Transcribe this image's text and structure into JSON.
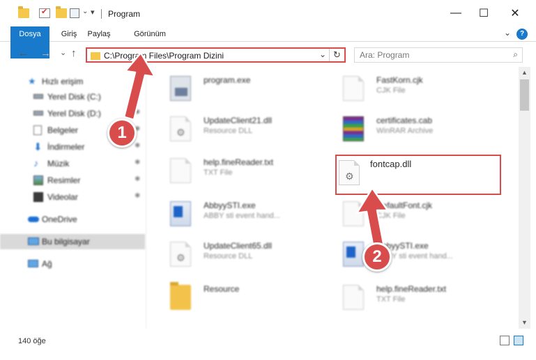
{
  "window": {
    "title": "Program",
    "min_glyph": "—",
    "max_glyph": "☐",
    "close_glyph": "✕"
  },
  "ribbon": {
    "tabs": [
      "Dosya",
      "Giriş",
      "Paylaş",
      "Görünüm"
    ],
    "help_glyph": "?",
    "expand_glyph": "⌄"
  },
  "nav": {
    "back_glyph": "←",
    "forward_glyph": "→",
    "recent_glyph": "⌄",
    "up_glyph": "↑",
    "path": "C:\\Program Files\\Program Dizini",
    "dropdown_glyph": "⌄",
    "refresh_glyph": "↻",
    "search_placeholder": "Ara: Program",
    "search_glyph": "⌕"
  },
  "sidebar": {
    "pin_glyph": "✱",
    "items": [
      {
        "label": "Hızlı erişim",
        "icon": "star-icon"
      },
      {
        "label": "Yerel Disk (C:)",
        "icon": "drive-icon"
      },
      {
        "label": "Yerel Disk (D:)",
        "icon": "drive-icon"
      },
      {
        "label": "Belgeler",
        "icon": "documents-icon"
      },
      {
        "label": "İndirmeler",
        "icon": "download-icon"
      },
      {
        "label": "Müzik",
        "icon": "music-icon"
      },
      {
        "label": "Resimler",
        "icon": "pictures-icon"
      },
      {
        "label": "Videolar",
        "icon": "videos-icon"
      },
      {
        "label": "OneDrive",
        "icon": "cloud-icon"
      },
      {
        "label": "Bu bilgisayar",
        "icon": "computer-icon"
      },
      {
        "label": "Ağ",
        "icon": "network-icon"
      }
    ]
  },
  "files": [
    {
      "name": "program.exe",
      "type": ""
    },
    {
      "name": "FastKorn.cjk",
      "type": "CJK File"
    },
    {
      "name": "UpdateClient21.dll",
      "type": "Resource DLL"
    },
    {
      "name": "certificates.cab",
      "type": "WinRAR Archive"
    },
    {
      "name": "help.fineReader.txt",
      "type": "TXT File"
    },
    {
      "name": "fontcap.dll",
      "type": ""
    },
    {
      "name": "AbbyySTI.exe",
      "type": "ABBY sti event hand..."
    },
    {
      "name": "DefaultFont.cjk",
      "type": "CJK File"
    },
    {
      "name": "UpdateClient65.dll",
      "type": "Resource DLL"
    },
    {
      "name": "AbbyySTI.exe",
      "type": "ABBY sti event hand..."
    },
    {
      "name": "Resource",
      "type": ""
    },
    {
      "name": "help.fineReader.txt",
      "type": "TXT File"
    }
  ],
  "status": {
    "count": "140 öğe"
  },
  "scroll_glyphs": {
    "up": "▲",
    "down": "▼"
  },
  "annotations": {
    "step1": "1",
    "step2": "2",
    "color": "#d94c4c"
  },
  "colors": {
    "accent": "#1979ca",
    "highlight": "#d94c4c",
    "folder": "#f5c84c"
  }
}
